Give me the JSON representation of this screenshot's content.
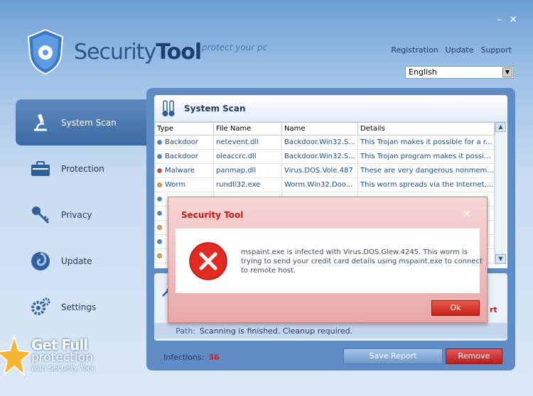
{
  "app": {
    "name_part1": "Security",
    "name_part2": "Tool",
    "tagline": "protect your pc"
  },
  "window_controls": {
    "minimize": "–",
    "close": "✕"
  },
  "top_links": {
    "registration": "Registration",
    "update": "Update",
    "support": "Support"
  },
  "language": {
    "selected": "English"
  },
  "sidebar": {
    "items": [
      {
        "label": "System Scan",
        "icon": "microscope-icon",
        "active": true
      },
      {
        "label": "Protection",
        "icon": "briefcase-icon",
        "active": false
      },
      {
        "label": "Privacy",
        "icon": "key-icon",
        "active": false
      },
      {
        "label": "Update",
        "icon": "swirl-icon",
        "active": false
      },
      {
        "label": "Settings",
        "icon": "gears-icon",
        "active": false
      }
    ]
  },
  "promo": {
    "line1": "Get Full",
    "line2": "protection",
    "line3": "with Security Tool"
  },
  "scan": {
    "title": "System Scan",
    "columns": [
      "Type",
      "File Name",
      "Name",
      "Details"
    ],
    "rows": [
      {
        "type": "Backdoor",
        "file": "netevent.dll",
        "name": "Backdoor.Win32.S...",
        "details": "This Trojan makes it possible for a r...",
        "color": "#2d8be0"
      },
      {
        "type": "Backdoor",
        "file": "oleaccrc.dll",
        "name": "Backdoor.Win32.S...",
        "details": "This Trojan program makes it possibl...",
        "color": "#2d8be0"
      },
      {
        "type": "Malware",
        "file": "panmap.dll",
        "name": "Virus.DOS.Vole.487",
        "details": "These are very dangerous nonmem...",
        "color": "#e0352d"
      },
      {
        "type": "Worm",
        "file": "rundll32.exe",
        "name": "Worm.Win32.Doo...",
        "details": "This worm spreads via the Internet,...",
        "color": "#f0a030"
      },
      {
        "type": "",
        "file": "",
        "name": "",
        "details": "",
        "color": "#2d8be0"
      },
      {
        "type": "",
        "file": "",
        "name": "",
        "details": "",
        "color": "#2d8be0"
      },
      {
        "type": "",
        "file": "",
        "name": "",
        "details": "",
        "color": "#f0a030"
      },
      {
        "type": "",
        "file": "",
        "name": "",
        "details": "",
        "color": "#2d8be0"
      },
      {
        "type": "",
        "file": "",
        "name": "",
        "details": "",
        "color": "#f0a030"
      }
    ]
  },
  "info": {
    "path_label": "Path:",
    "path_value": "Scanning is finished. Cleanup required.",
    "peek_text": "rt"
  },
  "footer": {
    "infections_label": "Infections:",
    "infections_count": "36",
    "save_report": "Save Report",
    "remove": "Remove"
  },
  "dialog": {
    "title": "Security Tool",
    "close": "✕",
    "message": "mspaint.exe is infected with Virus.DOS.Glew.4245. This worm is trying to send your credit card details using mspaint.exe to connect to remote host.",
    "ok": "Ok"
  },
  "colors": {
    "accent_red": "#c01a1a",
    "nav_active": "#3c6aa3",
    "panel": "#5f8cc4"
  }
}
